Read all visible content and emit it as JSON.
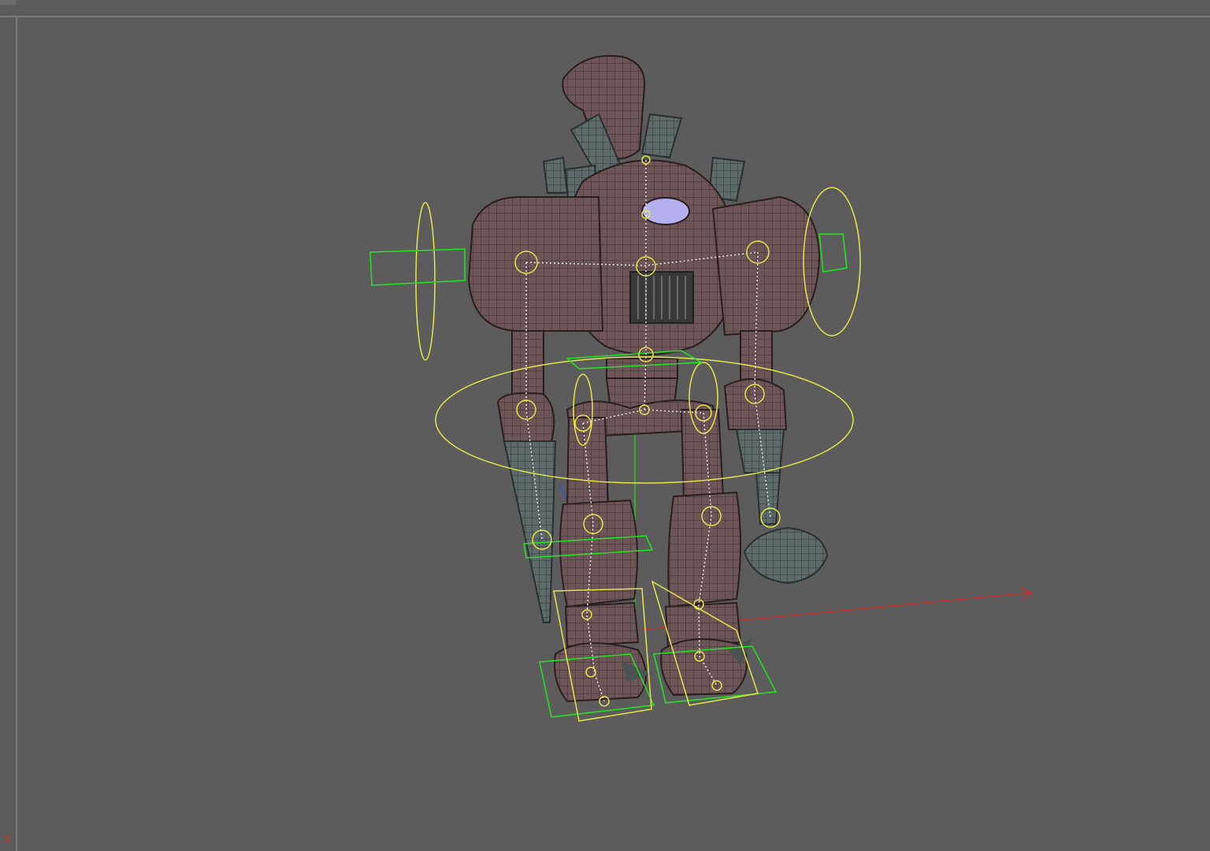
{
  "viewport": {
    "name": "3d-viewport",
    "background": "#5c5c5c",
    "view_axis_label": "X"
  },
  "scene": {
    "object": "robot-character-mesh",
    "mesh_color": "#6e5558",
    "mesh_wire_color": "#3b2c2e",
    "metal_color": "#5f6a6a",
    "eye_color": "#b7b0f0",
    "bone_color": "#e8e8e8",
    "control_color": "#e5e54a",
    "ik_box_color": "#22e622",
    "axis_x_color": "#c03030",
    "axis_y_color": "#3050c0",
    "axis_z_color": "#30c030"
  }
}
